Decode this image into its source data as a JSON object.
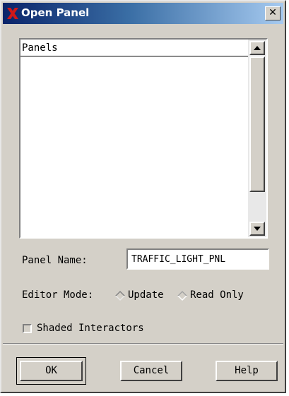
{
  "window": {
    "title": "Open Panel",
    "app_icon": "x-logo-icon",
    "close_icon": "close-icon",
    "close_glyph": "✕"
  },
  "panels_list": {
    "header": "Panels",
    "items": []
  },
  "panel_name": {
    "label": "Panel Name:",
    "value": "TRAFFIC_LIGHT_PNL"
  },
  "editor_mode": {
    "label": "Editor Mode:",
    "options": [
      "Update",
      "Read Only"
    ],
    "selected": "Update"
  },
  "shaded_interactors": {
    "label": "Shaded Interactors",
    "checked": false
  },
  "buttons": {
    "ok": "OK",
    "cancel": "Cancel",
    "help": "Help"
  },
  "colors": {
    "face": "#d4d0c8",
    "title_start": "#0a246a",
    "title_end": "#a6caf0",
    "logo": "#d01818"
  }
}
